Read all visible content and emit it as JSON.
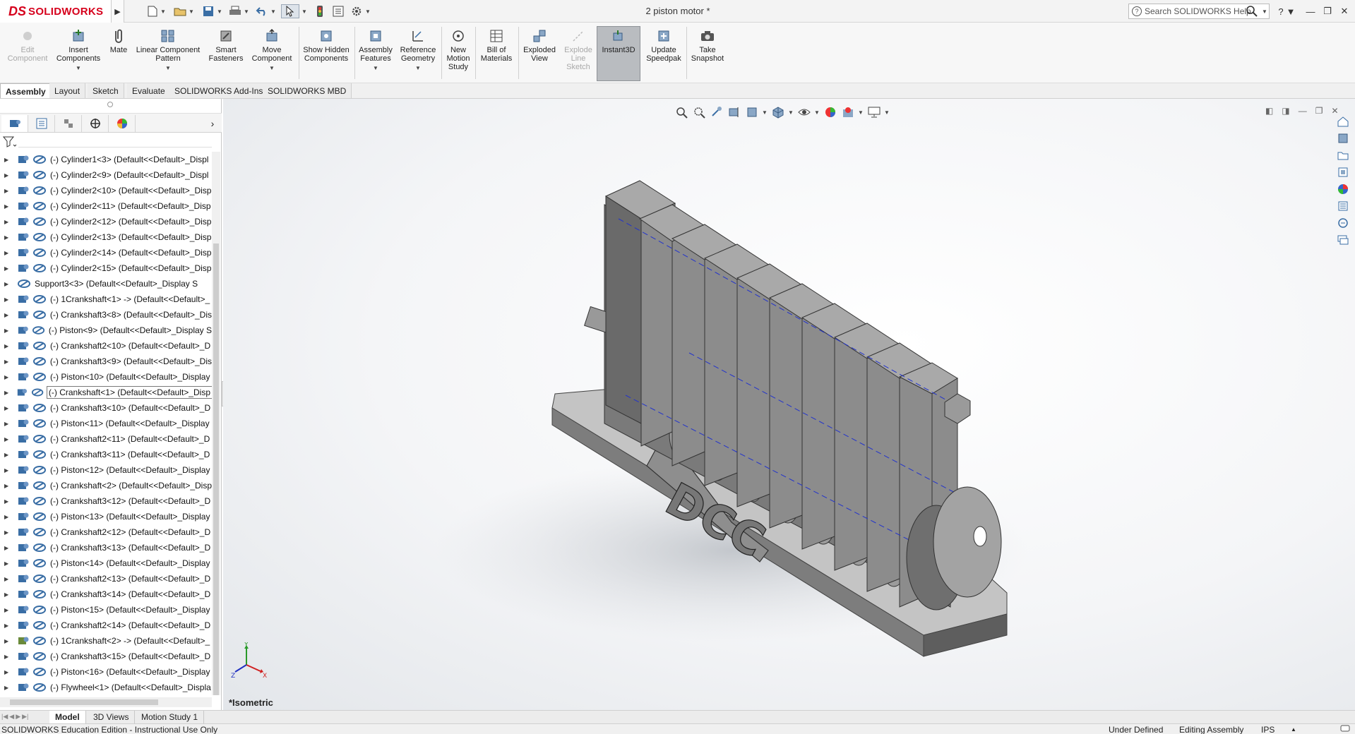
{
  "app": {
    "brand": "SOLIDWORKS",
    "doc_title": "2 piston motor *"
  },
  "search": {
    "placeholder": "Search SOLIDWORKS Help"
  },
  "ribbon": {
    "buttons": [
      {
        "label": "Edit Component",
        "enabled": false
      },
      {
        "label": "Insert Components"
      },
      {
        "label": "Mate"
      },
      {
        "label": "Linear Component Pattern"
      },
      {
        "label": "Smart Fasteners"
      },
      {
        "label": "Move Component"
      },
      {
        "label": "Show Hidden Components"
      },
      {
        "label": "Assembly Features"
      },
      {
        "label": "Reference Geometry"
      },
      {
        "label": "New Motion Study"
      },
      {
        "label": "Bill of Materials"
      },
      {
        "label": "Exploded View"
      },
      {
        "label": "Explode Line Sketch",
        "enabled": false
      },
      {
        "label": "Instant3D",
        "active": true
      },
      {
        "label": "Update Speedpak"
      },
      {
        "label": "Take Snapshot"
      }
    ]
  },
  "tabs": [
    "Assembly",
    "Layout",
    "Sketch",
    "Evaluate",
    "SOLIDWORKS Add-Ins",
    "SOLIDWORKS MBD"
  ],
  "tree": {
    "items": [
      "(-) Cylinder1<3> (Default<<Default>_Displ",
      "(-) Cylinder2<9> (Default<<Default>_Displ",
      "(-) Cylinder2<10> (Default<<Default>_Disp",
      "(-) Cylinder2<11> (Default<<Default>_Disp",
      "(-) Cylinder2<12> (Default<<Default>_Disp",
      "(-) Cylinder2<13> (Default<<Default>_Disp",
      "(-) Cylinder2<14> (Default<<Default>_Disp",
      "(-) Cylinder2<15> (Default<<Default>_Disp",
      "Support3<3> (Default<<Default>_Display S",
      "(-) 1Crankshaft<1> -> (Default<<Default>_",
      "(-) Crankshaft3<8> (Default<<Default>_Dis",
      "(-) Piston<9> (Default<<Default>_Display S",
      "(-) Crankshaft2<10> (Default<<Default>_D",
      "(-) Crankshaft3<9> (Default<<Default>_Dis",
      "(-) Piston<10> (Default<<Default>_Display",
      "(-) Crankshaft<1> (Default<<Default>_Disp",
      "(-) Crankshaft3<10> (Default<<Default>_D",
      "(-) Piston<11> (Default<<Default>_Display",
      "(-) Crankshaft2<11> (Default<<Default>_D",
      "(-) Crankshaft3<11> (Default<<Default>_D",
      "(-) Piston<12> (Default<<Default>_Display",
      "(-) Crankshaft<2> (Default<<Default>_Disp",
      "(-) Crankshaft3<12> (Default<<Default>_D",
      "(-) Piston<13> (Default<<Default>_Display",
      "(-) Crankshaft2<12> (Default<<Default>_D",
      "(-) Crankshaft3<13> (Default<<Default>_D",
      "(-) Piston<14> (Default<<Default>_Display",
      "(-) Crankshaft2<13> (Default<<Default>_D",
      "(-) Crankshaft3<14> (Default<<Default>_D",
      "(-) Piston<15> (Default<<Default>_Display",
      "(-) Crankshaft2<14> (Default<<Default>_D",
      "(-) 1Crankshaft<2> -> (Default<<Default>_",
      "(-) Crankshaft3<15> (Default<<Default>_D",
      "(-) Piston<16> (Default<<Default>_Display",
      "(-) Flywheel<1> (Default<<Default>_Displa"
    ],
    "selected_index": 15
  },
  "viewport": {
    "view_label": "*Isometric",
    "logo_text": "DCC"
  },
  "bottom_tabs": [
    "Model",
    "3D Views",
    "Motion Study 1"
  ],
  "status": {
    "left": "SOLIDWORKS Education Edition - Instructional Use Only",
    "definition": "Under Defined",
    "mode": "Editing Assembly",
    "units": "IPS"
  },
  "colors": {
    "brand_red": "#d6001c",
    "tree_icon_blue": "#3a6ea5",
    "model_gray": "#8a8a8a"
  }
}
